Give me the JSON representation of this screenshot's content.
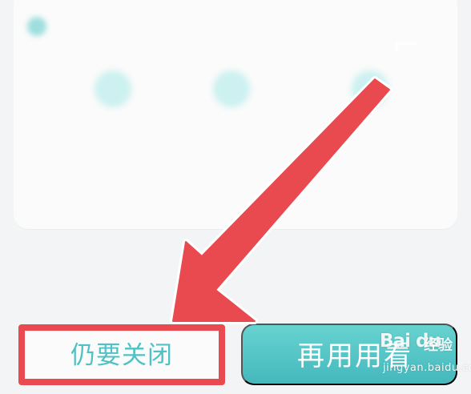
{
  "dialog": {
    "close_anyway_label": "仍要关闭",
    "try_again_label": "再用用看"
  },
  "watermark": {
    "brand": "Bai du",
    "label": "经验",
    "url": "jingyan.baidu.com"
  },
  "colors": {
    "accent": "#4fc2c5",
    "annotation": "#e84a50",
    "card_background": "#fbfbfb",
    "screen_background": "#f3f4f5"
  },
  "icons": {
    "title_marker": "teal-dot-icon",
    "corner_glyph": "corner-line-icon",
    "feature_icons": [
      "feature-icon-1",
      "feature-icon-2",
      "feature-icon-3"
    ],
    "annotation_arrow": "red-arrow-icon"
  }
}
